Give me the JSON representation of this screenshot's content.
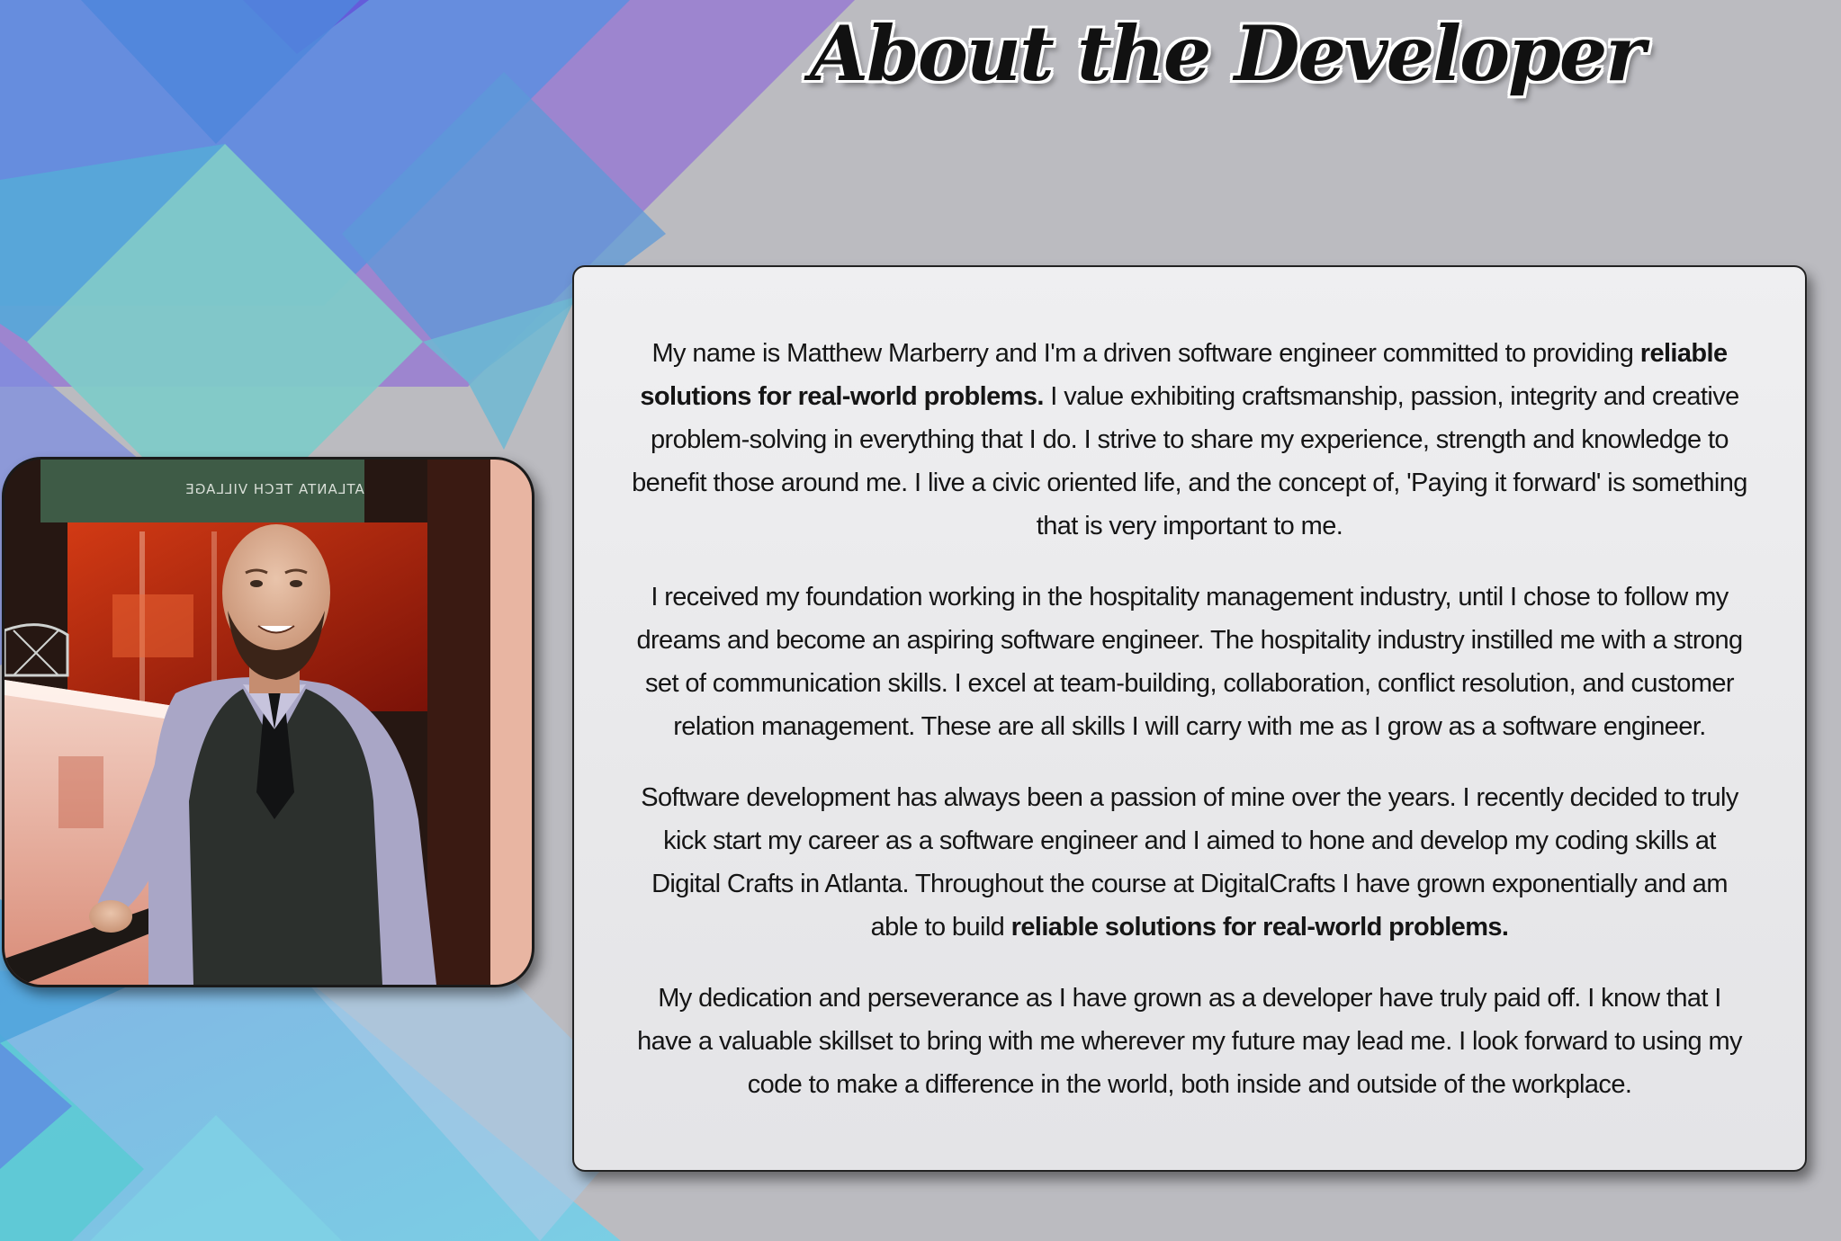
{
  "page": {
    "title": "About the Developer"
  },
  "profile": {
    "photo_alt": "Photo of Matthew Marberry",
    "sign_text": "ATLANTA TECH VILLAGE"
  },
  "bio": {
    "paragraphs": [
      {
        "segments": [
          {
            "text": "My name is Matthew Marberry and I'm a driven software engineer committed to providing ",
            "bold": false
          },
          {
            "text": "reliable solutions for real-world problems.",
            "bold": true
          },
          {
            "text": " I value exhibiting craftsmanship, passion, integrity and creative problem-solving in everything that I do. I strive to share my experience, strength and knowledge to benefit those around me. I live a civic oriented life, and the concept of, 'Paying it forward' is something that is very important to me.",
            "bold": false
          }
        ]
      },
      {
        "segments": [
          {
            "text": "I received my foundation working in the hospitality management industry, until I chose to follow my dreams and become an aspiring software engineer. The hospitality industry instilled me with a strong set of communication skills. I excel at team-building, collaboration, conflict resolution, and customer relation management. These are all skills I will carry with me as I grow as a software engineer.",
            "bold": false
          }
        ]
      },
      {
        "segments": [
          {
            "text": "Software development has always been a passion of mine over the years. I recently decided to truly kick start my career as a software engineer and I aimed to hone and develop my coding skills at Digital Crafts in Atlanta. Throughout the course at DigitalCrafts I have grown exponentially and am able to build ",
            "bold": false
          },
          {
            "text": "reliable solutions for real-world problems.",
            "bold": true
          }
        ]
      },
      {
        "segments": [
          {
            "text": "My dedication and perseverance as I have grown as a developer have truly paid off. I know that I have a valuable skillset to bring with me wherever my future may lead me. I look forward to using my code to make a difference in the world, both inside and outside of the workplace.",
            "bold": false
          }
        ]
      }
    ]
  },
  "colors": {
    "page_background": "#bbbbc0",
    "tile_blue": "#4a8fd8",
    "tile_teal": "#7ecbc9",
    "tile_purple": "#9b7ad0",
    "card_background": "#ededef",
    "text": "#151515"
  }
}
